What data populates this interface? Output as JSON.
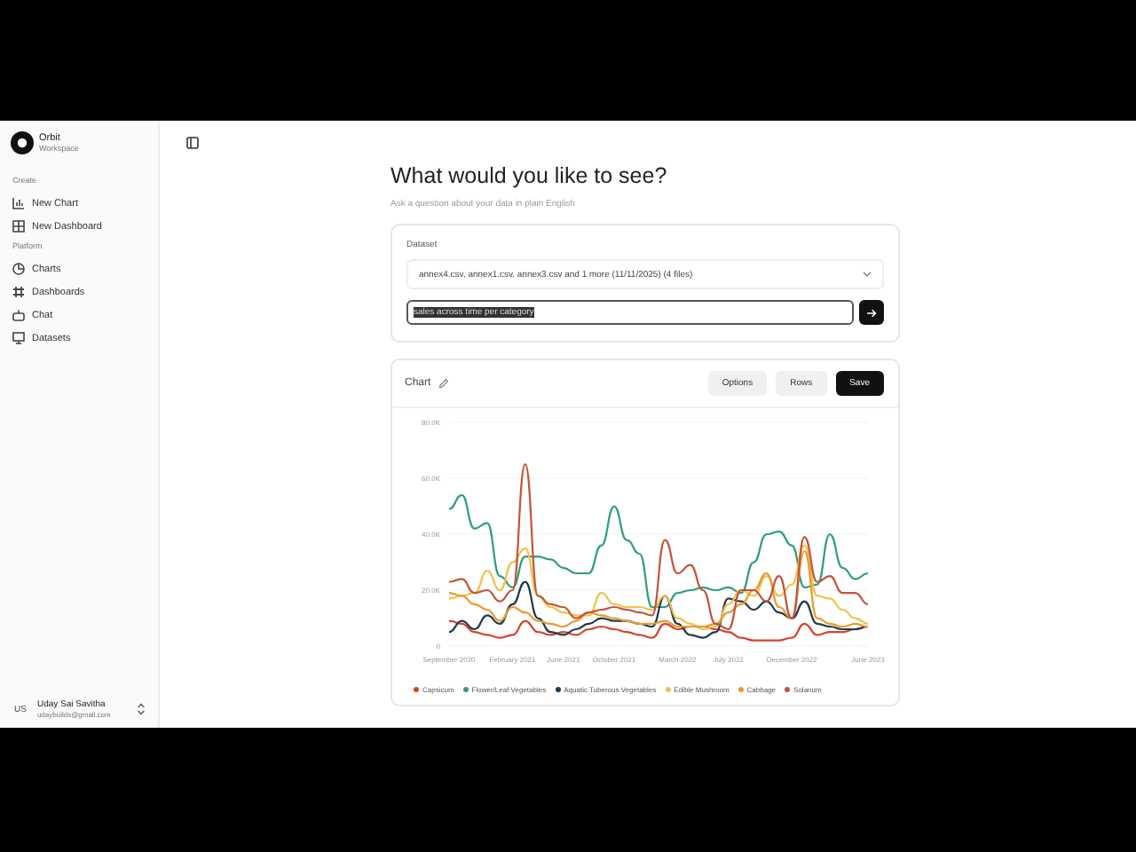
{
  "sidebar": {
    "brand": {
      "name": "Orbit",
      "subtitle": "Workspace"
    },
    "sections": [
      {
        "title": "Create",
        "items": [
          {
            "label": "New Chart"
          },
          {
            "label": "New Dashboard"
          }
        ]
      },
      {
        "title": "Platform",
        "items": [
          {
            "label": "Charts"
          },
          {
            "label": "Dashboards"
          },
          {
            "label": "Chat"
          },
          {
            "label": "Datasets"
          }
        ]
      }
    ],
    "user": {
      "initials": "US",
      "name": "Uday Sai Savitha",
      "email": "udaybuilds@gmail.com"
    }
  },
  "main": {
    "heading": "What would you like to see?",
    "subheading": "Ask a question about your data in plain English",
    "query_card": {
      "dataset_label": "Dataset",
      "dataset_value": "annex4.csv, annex1.csv, annex3.csv and 1 more (11/11/2025) (4 files)",
      "query_value": "sales across time per category"
    },
    "chart_card": {
      "title": "Chart",
      "buttons": [
        {
          "label": "Options",
          "kind": "secondary"
        },
        {
          "label": "Rows",
          "kind": "secondary"
        },
        {
          "label": "Save",
          "kind": "primary"
        }
      ],
      "chart_data": {
        "type": "line",
        "grid": true,
        "legend": "bottom",
        "categories": [
          "September 2020",
          null,
          null,
          null,
          null,
          "February 2021",
          null,
          null,
          null,
          "June 2021",
          null,
          null,
          null,
          "October 2021",
          null,
          null,
          null,
          null,
          "March 2022",
          null,
          null,
          null,
          "July 2022",
          null,
          null,
          null,
          null,
          "December 2022",
          null,
          null,
          null,
          null,
          null,
          "June 2023"
        ],
        "ylim": [
          0,
          80000
        ],
        "yticks": [
          {
            "value": 0,
            "label": "0"
          },
          {
            "value": 20000,
            "label": "20.0K"
          },
          {
            "value": 40000,
            "label": "40.0K"
          },
          {
            "value": 60000,
            "label": "60.0K"
          },
          {
            "value": 80000,
            "label": "80.0K"
          }
        ],
        "series": [
          {
            "name": "Capsicum",
            "color": "#d9412b",
            "values": [
              9000,
              8000,
              5000,
              4000,
              3000,
              4000,
              9000,
              5000,
              4000,
              5000,
              4000,
              6000,
              7000,
              6000,
              5000,
              4000,
              3000,
              8000,
              6000,
              7000,
              7000,
              6000,
              5000,
              3000,
              2000,
              2000,
              2000,
              3000,
              8000,
              4000,
              5000,
              5000,
              6000,
              7000
            ]
          },
          {
            "name": "Flower/Leaf Vegetables",
            "color": "#2e9e7d",
            "values": [
              49000,
              54000,
              42000,
              44000,
              25000,
              21000,
              32000,
              32000,
              31000,
              28000,
              26000,
              26000,
              36000,
              50000,
              38000,
              33000,
              14000,
              14000,
              19000,
              20000,
              21000,
              20000,
              21000,
              19000,
              30000,
              40000,
              41000,
              36000,
              21000,
              22000,
              40000,
              28000,
              24000,
              26000
            ]
          },
          {
            "name": "Aquatic Tuberous Vegetables",
            "color": "#1f3b4d",
            "values": [
              5000,
              9000,
              6000,
              11000,
              8000,
              15000,
              23000,
              10000,
              5000,
              4000,
              6000,
              8000,
              10000,
              9000,
              9000,
              8000,
              7000,
              18000,
              8000,
              4000,
              3000,
              5000,
              17000,
              16000,
              13000,
              16000,
              12000,
              10000,
              16000,
              8000,
              7000,
              6000,
              6000,
              7000
            ]
          },
          {
            "name": "Edible Mushroom",
            "color": "#f2c14e",
            "values": [
              17000,
              18000,
              19000,
              27000,
              20000,
              30000,
              35000,
              18000,
              14000,
              12000,
              11000,
              11000,
              19000,
              15000,
              14000,
              14000,
              13000,
              18000,
              10000,
              8000,
              6000,
              7000,
              15000,
              20000,
              18000,
              25000,
              18000,
              22000,
              36000,
              18000,
              17000,
              13000,
              10000,
              8000
            ]
          },
          {
            "name": "Cabbage",
            "color": "#e89a2c",
            "values": [
              19000,
              18000,
              15000,
              13000,
              9000,
              14000,
              12000,
              9000,
              8000,
              7000,
              9000,
              12000,
              11000,
              10000,
              9000,
              8000,
              8000,
              9000,
              7000,
              7000,
              7000,
              8000,
              12000,
              15000,
              20000,
              26000,
              14000,
              10000,
              34000,
              10000,
              8000,
              7000,
              8000,
              7000
            ]
          },
          {
            "name": "Solanum",
            "color": "#c2543a",
            "values": [
              23000,
              24000,
              19000,
              20000,
              16000,
              20000,
              65000,
              18000,
              15000,
              14000,
              10000,
              12000,
              13000,
              14000,
              13000,
              12000,
              11000,
              38000,
              26000,
              29000,
              20000,
              8000,
              6000,
              20000,
              20000,
              16000,
              25000,
              10000,
              39000,
              23000,
              25000,
              19000,
              19000,
              15000
            ]
          }
        ]
      }
    }
  }
}
